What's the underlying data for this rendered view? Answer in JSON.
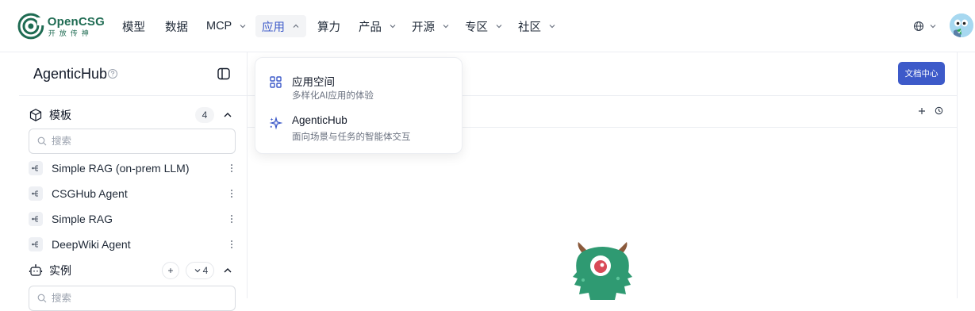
{
  "brand": {
    "name": "OpenCSG",
    "tagline": "开放传神",
    "color": "#1e6b52"
  },
  "nav": {
    "items": [
      {
        "label": "模型",
        "has_dropdown": false
      },
      {
        "label": "数据",
        "has_dropdown": false
      },
      {
        "label": "MCP",
        "has_dropdown": true
      },
      {
        "label": "应用",
        "has_dropdown": true,
        "active": true
      },
      {
        "label": "算力",
        "has_dropdown": false
      },
      {
        "label": "产品",
        "has_dropdown": true
      },
      {
        "label": "开源",
        "has_dropdown": true
      },
      {
        "label": "专区",
        "has_dropdown": true
      },
      {
        "label": "社区",
        "has_dropdown": true
      }
    ],
    "language_icon": "globe-icon",
    "accent": "#3d5ac9"
  },
  "dropdown": {
    "items": [
      {
        "title": "应用空间",
        "desc": "多样化AI应用的体验",
        "icon": "grid-icon"
      },
      {
        "title": "AgenticHub",
        "desc": "面向场景与任务的智能体交互",
        "icon": "sparkle-icon"
      }
    ]
  },
  "sidebar": {
    "title": "AgenticHub",
    "templates": {
      "label": "模板",
      "count": "4",
      "search_placeholder": "搜索",
      "items": [
        {
          "label": "Simple RAG (on-prem LLM)"
        },
        {
          "label": "CSGHub Agent"
        },
        {
          "label": "Simple RAG"
        },
        {
          "label": "DeepWiki Agent"
        }
      ]
    },
    "instances": {
      "label": "实例",
      "add_label": "+",
      "count": "4",
      "search_placeholder": "搜索"
    }
  },
  "main": {
    "doc_button": "文档中心"
  }
}
